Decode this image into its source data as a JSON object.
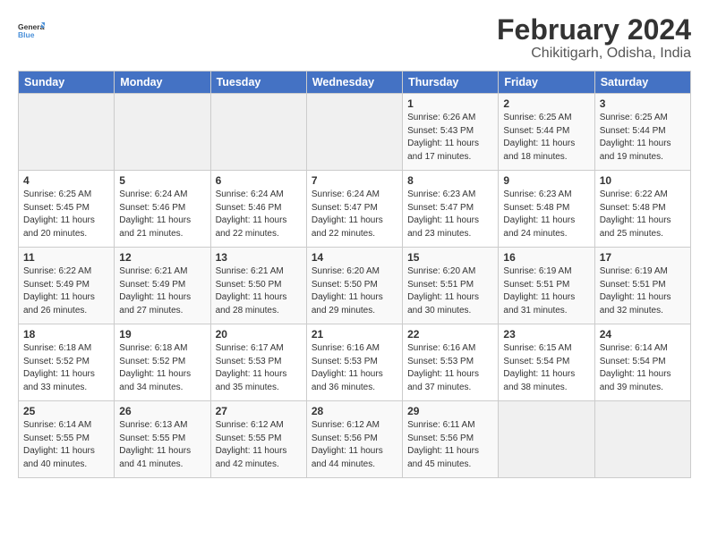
{
  "logo": {
    "line1": "General",
    "line2": "Blue"
  },
  "title": "February 2024",
  "subtitle": "Chikitigarh, Odisha, India",
  "header_days": [
    "Sunday",
    "Monday",
    "Tuesday",
    "Wednesday",
    "Thursday",
    "Friday",
    "Saturday"
  ],
  "weeks": [
    [
      {
        "day": "",
        "info": ""
      },
      {
        "day": "",
        "info": ""
      },
      {
        "day": "",
        "info": ""
      },
      {
        "day": "",
        "info": ""
      },
      {
        "day": "1",
        "info": "Sunrise: 6:26 AM\nSunset: 5:43 PM\nDaylight: 11 hours and 17 minutes."
      },
      {
        "day": "2",
        "info": "Sunrise: 6:25 AM\nSunset: 5:44 PM\nDaylight: 11 hours and 18 minutes."
      },
      {
        "day": "3",
        "info": "Sunrise: 6:25 AM\nSunset: 5:44 PM\nDaylight: 11 hours and 19 minutes."
      }
    ],
    [
      {
        "day": "4",
        "info": "Sunrise: 6:25 AM\nSunset: 5:45 PM\nDaylight: 11 hours and 20 minutes."
      },
      {
        "day": "5",
        "info": "Sunrise: 6:24 AM\nSunset: 5:46 PM\nDaylight: 11 hours and 21 minutes."
      },
      {
        "day": "6",
        "info": "Sunrise: 6:24 AM\nSunset: 5:46 PM\nDaylight: 11 hours and 22 minutes."
      },
      {
        "day": "7",
        "info": "Sunrise: 6:24 AM\nSunset: 5:47 PM\nDaylight: 11 hours and 22 minutes."
      },
      {
        "day": "8",
        "info": "Sunrise: 6:23 AM\nSunset: 5:47 PM\nDaylight: 11 hours and 23 minutes."
      },
      {
        "day": "9",
        "info": "Sunrise: 6:23 AM\nSunset: 5:48 PM\nDaylight: 11 hours and 24 minutes."
      },
      {
        "day": "10",
        "info": "Sunrise: 6:22 AM\nSunset: 5:48 PM\nDaylight: 11 hours and 25 minutes."
      }
    ],
    [
      {
        "day": "11",
        "info": "Sunrise: 6:22 AM\nSunset: 5:49 PM\nDaylight: 11 hours and 26 minutes."
      },
      {
        "day": "12",
        "info": "Sunrise: 6:21 AM\nSunset: 5:49 PM\nDaylight: 11 hours and 27 minutes."
      },
      {
        "day": "13",
        "info": "Sunrise: 6:21 AM\nSunset: 5:50 PM\nDaylight: 11 hours and 28 minutes."
      },
      {
        "day": "14",
        "info": "Sunrise: 6:20 AM\nSunset: 5:50 PM\nDaylight: 11 hours and 29 minutes."
      },
      {
        "day": "15",
        "info": "Sunrise: 6:20 AM\nSunset: 5:51 PM\nDaylight: 11 hours and 30 minutes."
      },
      {
        "day": "16",
        "info": "Sunrise: 6:19 AM\nSunset: 5:51 PM\nDaylight: 11 hours and 31 minutes."
      },
      {
        "day": "17",
        "info": "Sunrise: 6:19 AM\nSunset: 5:51 PM\nDaylight: 11 hours and 32 minutes."
      }
    ],
    [
      {
        "day": "18",
        "info": "Sunrise: 6:18 AM\nSunset: 5:52 PM\nDaylight: 11 hours and 33 minutes."
      },
      {
        "day": "19",
        "info": "Sunrise: 6:18 AM\nSunset: 5:52 PM\nDaylight: 11 hours and 34 minutes."
      },
      {
        "day": "20",
        "info": "Sunrise: 6:17 AM\nSunset: 5:53 PM\nDaylight: 11 hours and 35 minutes."
      },
      {
        "day": "21",
        "info": "Sunrise: 6:16 AM\nSunset: 5:53 PM\nDaylight: 11 hours and 36 minutes."
      },
      {
        "day": "22",
        "info": "Sunrise: 6:16 AM\nSunset: 5:53 PM\nDaylight: 11 hours and 37 minutes."
      },
      {
        "day": "23",
        "info": "Sunrise: 6:15 AM\nSunset: 5:54 PM\nDaylight: 11 hours and 38 minutes."
      },
      {
        "day": "24",
        "info": "Sunrise: 6:14 AM\nSunset: 5:54 PM\nDaylight: 11 hours and 39 minutes."
      }
    ],
    [
      {
        "day": "25",
        "info": "Sunrise: 6:14 AM\nSunset: 5:55 PM\nDaylight: 11 hours and 40 minutes."
      },
      {
        "day": "26",
        "info": "Sunrise: 6:13 AM\nSunset: 5:55 PM\nDaylight: 11 hours and 41 minutes."
      },
      {
        "day": "27",
        "info": "Sunrise: 6:12 AM\nSunset: 5:55 PM\nDaylight: 11 hours and 42 minutes."
      },
      {
        "day": "28",
        "info": "Sunrise: 6:12 AM\nSunset: 5:56 PM\nDaylight: 11 hours and 44 minutes."
      },
      {
        "day": "29",
        "info": "Sunrise: 6:11 AM\nSunset: 5:56 PM\nDaylight: 11 hours and 45 minutes."
      },
      {
        "day": "",
        "info": ""
      },
      {
        "day": "",
        "info": ""
      }
    ]
  ]
}
